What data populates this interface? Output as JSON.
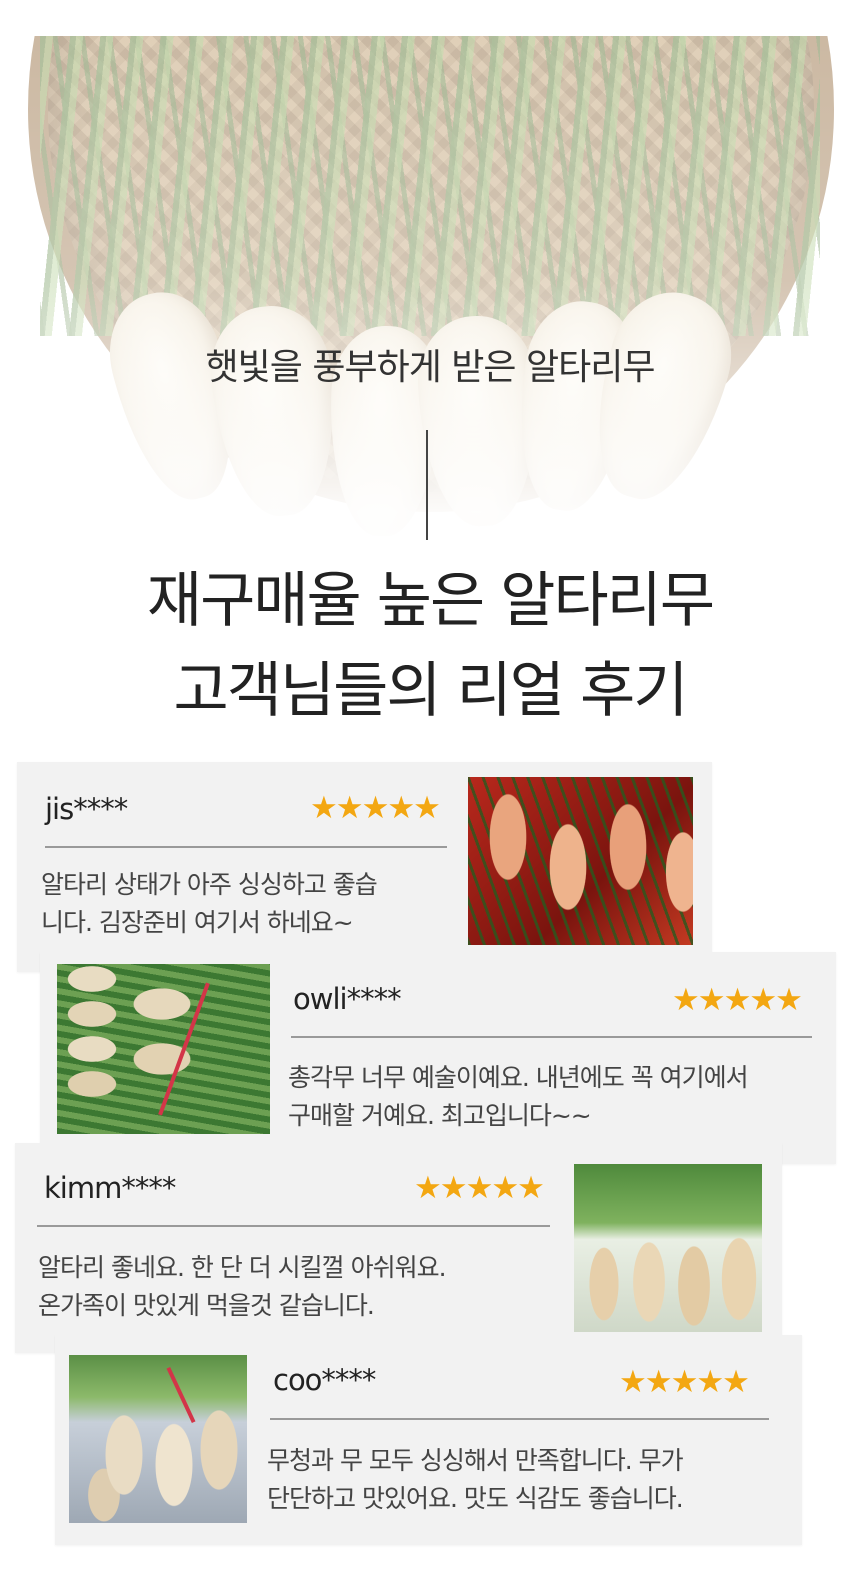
{
  "hero": {
    "subtitle": "햇빛을 풍부하게 받은 알타리무",
    "title_line1": "재구매율 높은 알타리무",
    "title_line2": "고객님들의 리얼 후기"
  },
  "reviews": [
    {
      "username": "jis****",
      "stars": "★★★★★",
      "rating": 5,
      "text_line1": "알타리 상태가 아주 싱싱하고 좋습",
      "text_line2": "니다. 김장준비 여기서 하네요~",
      "photo": "kimchi-photo"
    },
    {
      "username": "owli****",
      "stars": "★★★★★",
      "rating": 5,
      "text_line1": "총각무 너무 예술이예요. 내년에도 꼭 여기에서",
      "text_line2": "구매할 거예요. 최고입니다~~",
      "photo": "radish-bundle-photo"
    },
    {
      "username": "kimm****",
      "stars": "★★★★★",
      "rating": 5,
      "text_line1": "알타리 좋네요. 한 단 더 시킬껄 아쉬워요.",
      "text_line2": "온가족이 맛있게 먹을것 같습니다.",
      "photo": "standing-radish-photo"
    },
    {
      "username": "coo****",
      "stars": "★★★★★",
      "rating": 5,
      "text_line1": "무청과 무 모두 싱싱해서 만족합니다. 무가",
      "text_line2": "단단하고 맛있어요. 맛도 식감도 좋습니다.",
      "photo": "held-radish-photo"
    }
  ],
  "colors": {
    "star": "#f3a712",
    "card_background": "#f2f2f2",
    "text": "#222222"
  }
}
